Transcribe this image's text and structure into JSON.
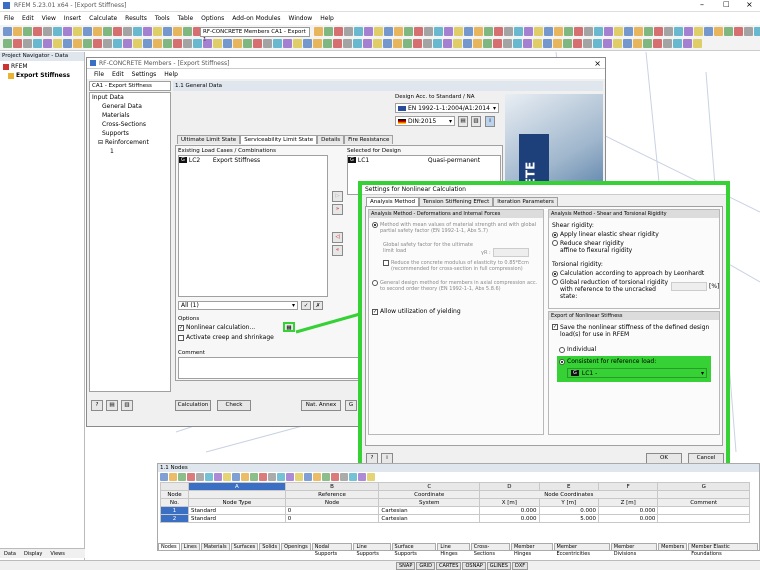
{
  "app": {
    "title": "RFEM 5.23.01 x64 - [Export Stiffness]",
    "menu": [
      "File",
      "Edit",
      "View",
      "Insert",
      "Calculate",
      "Results",
      "Tools",
      "Table",
      "Options",
      "Add-on Modules",
      "Window",
      "Help"
    ],
    "toolbar_module": "RF-CONCRETE Members CA1 - Export 1"
  },
  "navigator": {
    "title": "Project Navigator - Data",
    "root": "RFEM",
    "model": "Export Stiffness",
    "tabs": [
      "Data",
      "Display",
      "Views"
    ]
  },
  "module": {
    "title": "RF-CONCRETE Members - [Export Stiffness]",
    "menu": [
      "File",
      "Edit",
      "Settings",
      "Help"
    ],
    "case_select": "CA1 - Export Stiffness",
    "tree_root": "Input Data",
    "tree_items": [
      "General Data",
      "Materials",
      "Cross-Sections",
      "Supports"
    ],
    "tree_reinf": "Reinforcement",
    "tree_reinf_child": "1",
    "section_title": "1.1 General Data",
    "design_label": "Design Acc. to Standard / NA",
    "standard": "EN 1992-1-1:2004/A1:2014",
    "na": "DIN:2015",
    "tabs": [
      "Ultimate Limit State",
      "Serviceability Limit State",
      "Details",
      "Fire Resistance"
    ],
    "existing_label": "Existing Load Cases / Combinations",
    "existing_item_tag": "G",
    "existing_item_id": "LC2",
    "existing_item_name": "Export Stiffness",
    "selected_label": "Selected for Design",
    "selected_item_tag": "G",
    "selected_item_id": "LC1",
    "selected_item_type": "Quasi-permanent",
    "filter_all": "All (1)",
    "options_label": "Options",
    "opt_nonlinear": "Nonlinear calculation...",
    "opt_creep": "Activate creep and shrinkage",
    "comment_label": "Comment",
    "btn_calculation": "Calculation",
    "btn_check": "Check",
    "btn_annex": "Nat. Annex",
    "btn_g": "G",
    "banner_text": "CRETE"
  },
  "dialog": {
    "title": "Settings for Nonlinear Calculation",
    "tabs": [
      "Analysis Method",
      "Tension Stiffening Effect",
      "Iteration Parameters"
    ],
    "left_head": "Analysis Method - Deformations and Internal Forces",
    "m1": "Method with mean values of material strength and with global partial safety factor (EN 1992-1-1, Abs 5.7)",
    "safety": "Global safety factor for the ultimate limit load",
    "gamma": "γR :",
    "reduce": "Reduce the concrete modulus of elasticity to 0.85*Ecm (recommended for cross-section in full compression)",
    "m2": "General design method for members in axial compression acc. to second order theory (EN 1992-1-1, Abs 5.8.6)",
    "yield": "Allow utilization of yielding",
    "right_head": "Analysis Method - Shear and Torsional Rigidity",
    "shear_label": "Shear rigidity:",
    "shear_opt1": "Apply linear elastic shear rigidity",
    "shear_opt2": "Reduce shear rigidity affine to flexural rigidity",
    "tors_label": "Torsional rigidity:",
    "tors_opt1": "Calculation according to approach by Leonhardt",
    "tors_opt2": "Global reduction of torsional rigidity with reference to the uncracked state:",
    "tors_unit": "[%]",
    "export_head": "Export of Nonlinear Stiffness",
    "export_save": "Save the nonlinear stiffness of the defined design load(s) for use in RFEM",
    "individual": "Individual",
    "consistent": "Consistent for reference load:",
    "ref_tag": "G",
    "ref_load": "LC1 -",
    "ok": "OK",
    "cancel": "Cancel"
  },
  "table": {
    "title": "1.1 Nodes",
    "col_letters": [
      "A",
      "B",
      "C",
      "D",
      "E",
      "F",
      "G"
    ],
    "col_h1": [
      "Node",
      "",
      "Reference",
      "Coordinate",
      "Node Coordinates",
      "",
      ""
    ],
    "col_h2": [
      "No.",
      "Node Type",
      "Node",
      "System",
      "X [m]",
      "Y [m]",
      "Z [m]",
      "Comment"
    ],
    "rows": [
      [
        "1",
        "Standard",
        "0",
        "Cartesian",
        "0.000",
        "0.000",
        "0.000",
        ""
      ],
      [
        "2",
        "Standard",
        "0",
        "Cartesian",
        "0.000",
        "5.000",
        "0.000",
        ""
      ]
    ],
    "bottom_tabs": [
      "Nodes",
      "Lines",
      "Materials",
      "Surfaces",
      "Solids",
      "Openings",
      "Nodal Supports",
      "Line Supports",
      "Surface Supports",
      "Line Hinges",
      "Cross-Sections",
      "Member Hinges",
      "Member Eccentricities",
      "Member Divisions",
      "Members",
      "Member Elastic Foundations"
    ]
  },
  "status": [
    "SNAP",
    "GRID",
    "CARTES",
    "OSNAP",
    "GLINES",
    "DXF"
  ],
  "colors": {
    "highlight": "#35d135",
    "accent": "#3a6fc4"
  }
}
